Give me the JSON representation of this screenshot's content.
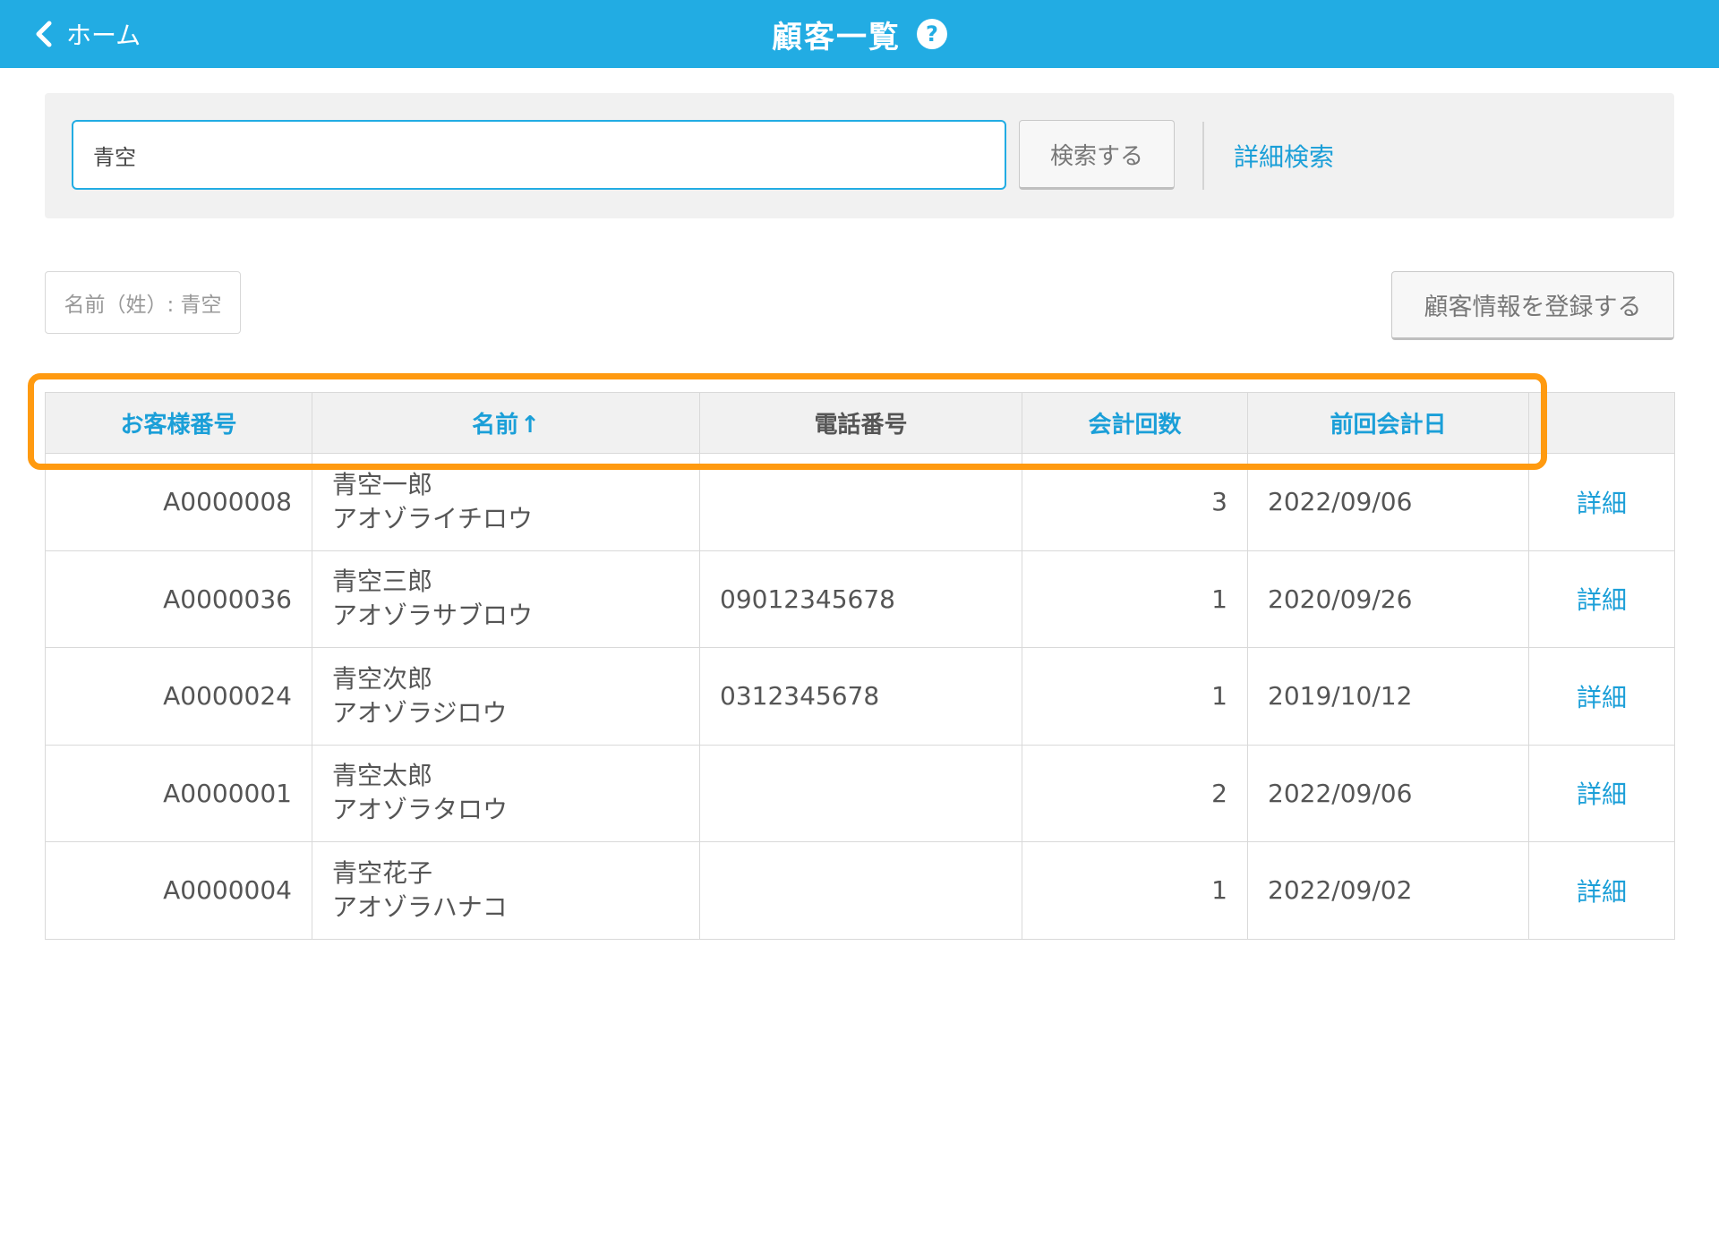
{
  "header": {
    "back_label": "ホーム",
    "title": "顧客一覧",
    "help_symbol": "?",
    "bg_color": "#22ace3"
  },
  "search": {
    "value": "青空",
    "button_label": "検索する",
    "advanced_link": "詳細検索"
  },
  "filter_chip": "名前（姓）: 青空",
  "register_button": "顧客情報を登録する",
  "table": {
    "columns": [
      "お客様番号",
      "名前",
      "電話番号",
      "会計回数",
      "前回会計日",
      ""
    ],
    "sort_arrow": "↑",
    "rows": [
      {
        "id": "A0000008",
        "name": "青空一郎",
        "kana": "アオゾライチロウ",
        "phone": "",
        "visits": "3",
        "last_date": "2022/09/06",
        "detail": "詳細"
      },
      {
        "id": "A0000036",
        "name": "青空三郎",
        "kana": "アオゾラサブロウ",
        "phone": "09012345678",
        "visits": "1",
        "last_date": "2020/09/26",
        "detail": "詳細"
      },
      {
        "id": "A0000024",
        "name": "青空次郎",
        "kana": "アオゾラジロウ",
        "phone": "0312345678",
        "visits": "1",
        "last_date": "2019/10/12",
        "detail": "詳細"
      },
      {
        "id": "A0000001",
        "name": "青空太郎",
        "kana": "アオゾラタロウ",
        "phone": "",
        "visits": "2",
        "last_date": "2022/09/06",
        "detail": "詳細"
      },
      {
        "id": "A0000004",
        "name": "青空花子",
        "kana": "アオゾラハナコ",
        "phone": "",
        "visits": "1",
        "last_date": "2022/09/02",
        "detail": "詳細"
      }
    ]
  },
  "colors": {
    "accent": "#22ace3",
    "link": "#1b9fd8",
    "highlight": "#ff9a10"
  }
}
